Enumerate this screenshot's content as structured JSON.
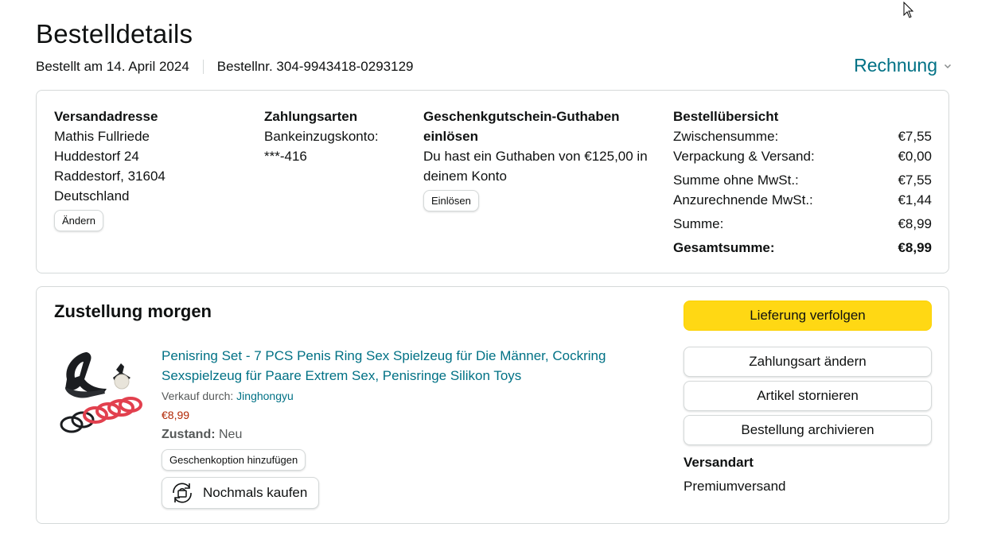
{
  "header": {
    "title": "Bestelldetails",
    "ordered_on": "Bestellt am 14. April 2024",
    "order_number": "Bestellnr. 304-9943418-0293129",
    "invoice_label": "Rechnung"
  },
  "shipping_address": {
    "heading": "Versandadresse",
    "lines": [
      "Mathis Fullriede",
      "Huddestorf 24",
      "Raddestorf, 31604",
      "Deutschland"
    ],
    "change_label": "Ändern"
  },
  "payment": {
    "heading": "Zahlungsarten",
    "method": "Bankeinzugskonto:",
    "account": "***-416"
  },
  "gift_card": {
    "heading_line1": "Geschenkgutschein-Guthaben",
    "heading_line2": "einlösen",
    "text_line1": "Du hast ein Guthaben von €125,00 in",
    "text_line2": "deinem Konto",
    "redeem_label": "Einlösen"
  },
  "summary": {
    "heading": "Bestellübersicht",
    "rows": [
      {
        "label": "Zwischensumme:",
        "value": "€7,55"
      },
      {
        "label": "Verpackung & Versand:",
        "value": "€0,00"
      },
      {
        "label": "Summe ohne MwSt.:",
        "value": "€7,55"
      },
      {
        "label": "Anzurechnende MwSt.:",
        "value": "€1,44"
      },
      {
        "label": "Summe:",
        "value": "€8,99"
      },
      {
        "label": "Gesamtsumme:",
        "value": "€8,99"
      }
    ]
  },
  "delivery": {
    "heading": "Zustellung morgen",
    "product": {
      "title_line1": "Penisring Set - 7 PCS Penis Ring Sex Spielzeug für Die Männer, Cockring",
      "title_line2": "Sexspielzeug für Paare Extrem Sex, Penisringe Silikon Toys",
      "sold_by_label": "Verkauf durch:",
      "seller": "Jinghongyu",
      "price": "€8,99",
      "condition_label": "Zustand:",
      "condition": "Neu",
      "gift_option_label": "Geschenkoption hinzufügen",
      "buy_again_label": "Nochmals kaufen"
    },
    "actions": {
      "track": "Lieferung verfolgen",
      "change_payment": "Zahlungsart ändern",
      "cancel_items": "Artikel stornieren",
      "archive": "Bestellung archivieren"
    },
    "shipping_method_label": "Versandart",
    "shipping_method": "Premiumversand"
  },
  "colors": {
    "link": "#007185",
    "price": "#b12704",
    "primary_button": "#ffd814",
    "border": "#d5d9d9"
  }
}
